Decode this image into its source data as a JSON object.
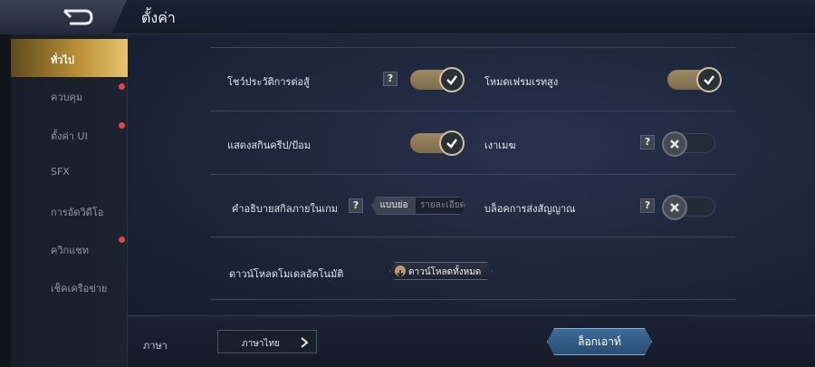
{
  "header": {
    "title": "ตั้งค่า",
    "back_icon": "back-arrow-icon"
  },
  "sidebar": {
    "items": [
      {
        "label": "ทั่วไป",
        "active": true,
        "badge": false
      },
      {
        "label": "ควบคุม",
        "active": false,
        "badge": true
      },
      {
        "label": "ตั้งค่า UI",
        "active": false,
        "badge": true
      },
      {
        "label": "SFX",
        "active": false,
        "badge": false
      },
      {
        "label": "การอัดวิดีโอ",
        "active": false,
        "badge": false
      },
      {
        "label": "ควิกแชท",
        "active": false,
        "badge": true
      },
      {
        "label": "เช็คเครือข่าย",
        "active": false,
        "badge": false
      }
    ]
  },
  "settings": {
    "battle_history": {
      "label": "โชว์ประวัติการต่อสู้",
      "help": "?",
      "state": "on"
    },
    "high_fps": {
      "label": "โหมดเฟรมเรทสูง",
      "state": "on"
    },
    "skill_range": {
      "label": "แสดงสกินครีป/ป้อม",
      "state": "on"
    },
    "shadow": {
      "label": "เงาเมฆ",
      "help": "?",
      "state": "off"
    },
    "skill_desc": {
      "label": "คำอธิบายสกิลภายในเกม",
      "help": "?",
      "options": [
        "แบบย่อ",
        "รายละเอียด"
      ],
      "selected": "แบบย่อ"
    },
    "block_signal": {
      "label": "บล็อคการส่งสัญญาณ",
      "help": "?",
      "state": "off"
    },
    "auto_download": {
      "label": "ดาวน์โหลดโมเดลอัตโนมัติ",
      "button_label": "ดาวน์โหลดทั้งหมด"
    }
  },
  "footer": {
    "language_label": "ภาษา",
    "language_value": "ภาษาไทย",
    "logout_label": "ล็อกเอาท์"
  },
  "colors": {
    "accent_gold": "#b78d34",
    "toggle_on": "#9d8a63",
    "badge_red": "#e04848",
    "logout_blue": "#3d6c98"
  }
}
